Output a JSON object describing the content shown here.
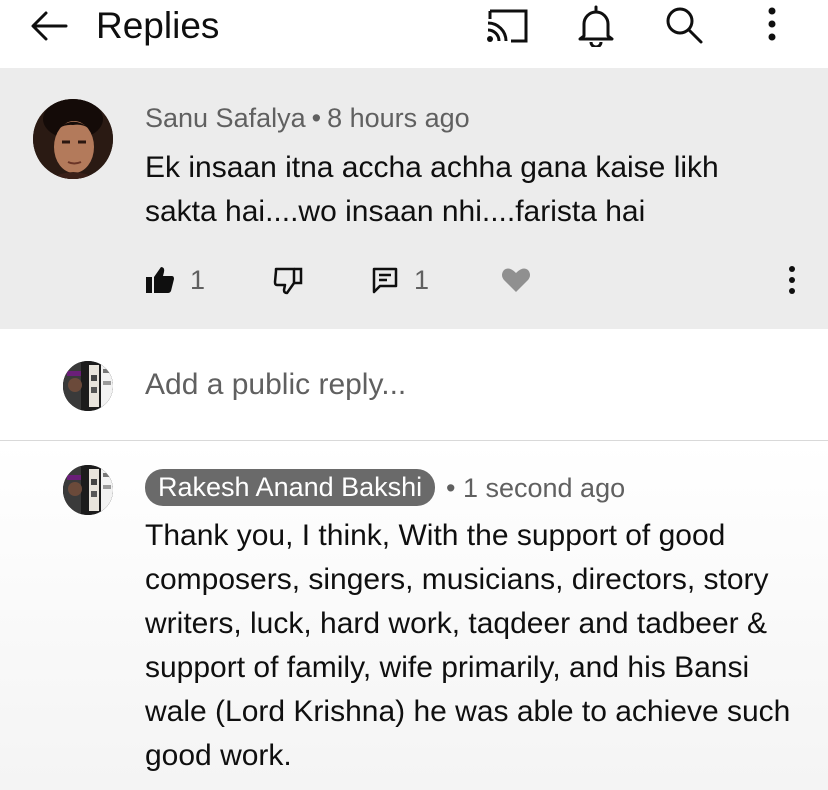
{
  "header": {
    "title": "Replies",
    "icons": [
      "back-arrow-icon",
      "cast-icon",
      "bell-icon",
      "search-icon",
      "more-vertical-icon"
    ]
  },
  "parent_comment": {
    "author": "Sanu Safalya",
    "separator": "•",
    "time": "8 hours ago",
    "text": "Ek insaan itna accha achha gana kaise likh sakta hai....wo insaan nhi....farista hai",
    "like_count": "1",
    "reply_count": "1",
    "icons": [
      "thumbs-up-icon",
      "thumbs-down-icon",
      "reply-icon",
      "heart-icon",
      "more-vertical-icon"
    ]
  },
  "reply_box": {
    "placeholder": "Add a public reply..."
  },
  "reply": {
    "author": "Rakesh Anand Bakshi",
    "separator": "•",
    "time": "1 second ago",
    "text": "Thank you, I think, With the support of good composers, singers, musicians, directors, story writers, luck, hard work, taqdeer and tadbeer & support of family, wife primarily, and his Bansi wale (Lord Krishna) he was able to achieve such good work."
  },
  "colors": {
    "parent_background": "#ececec",
    "secondary_text": "#606060",
    "author_chip": "#6a6a6a",
    "heart": "#909090"
  }
}
